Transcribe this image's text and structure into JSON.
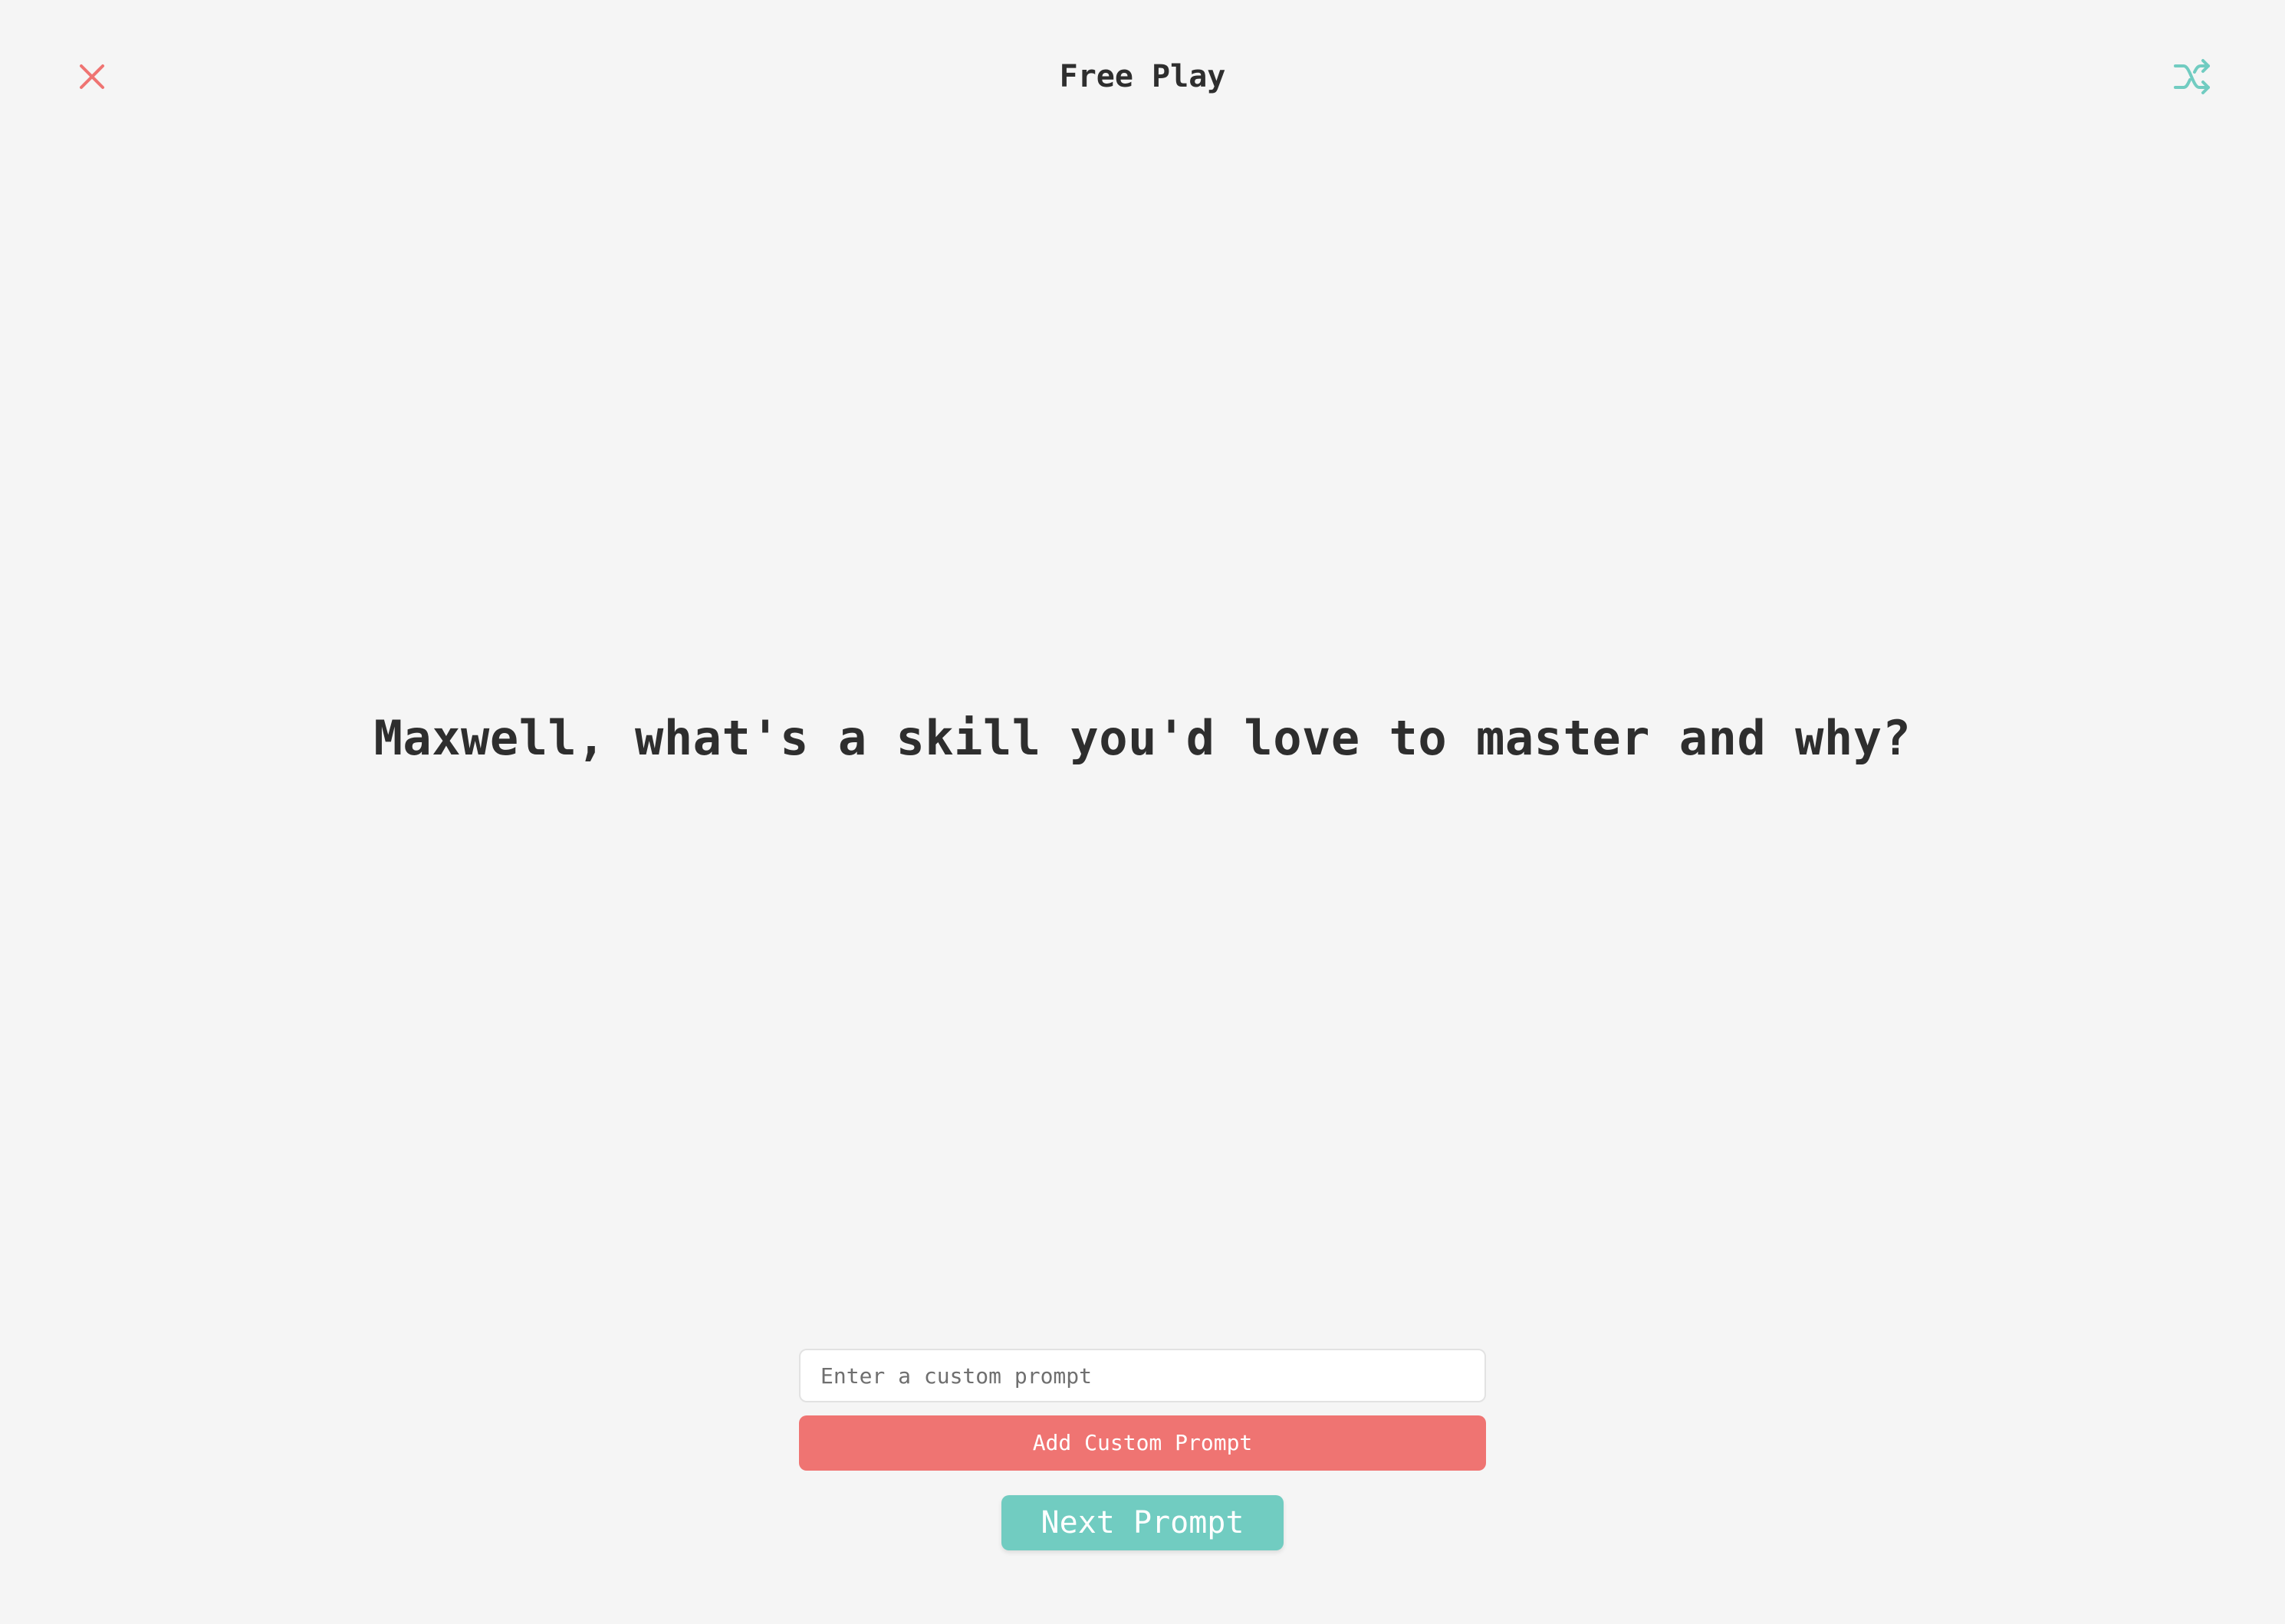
{
  "header": {
    "title": "Free Play",
    "close_icon": "close-icon",
    "shuffle_icon": "shuffle-icon"
  },
  "main": {
    "prompt": "Maxwell, what's a skill you'd love to master and why?"
  },
  "custom_prompt": {
    "value": "",
    "placeholder": "Enter a custom prompt",
    "add_label": "Add Custom Prompt"
  },
  "footer": {
    "next_label": "Next Prompt"
  },
  "colors": {
    "background": "#f5f5f5",
    "text": "#2e2e2e",
    "accent_red": "#ef7472",
    "accent_teal": "#71ccc1"
  }
}
